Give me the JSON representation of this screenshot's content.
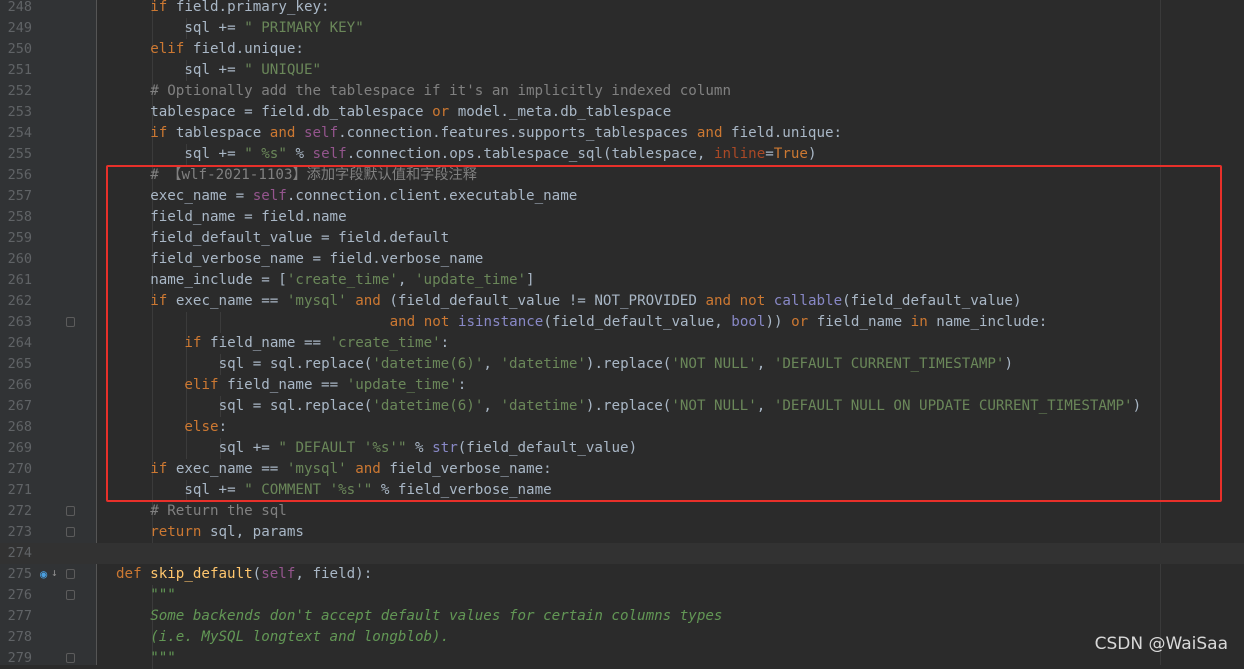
{
  "editor": {
    "lines": [
      {
        "num": "248",
        "tokens": [
          [
            "if",
            "kw"
          ],
          [
            " field.primary_key:",
            "op"
          ]
        ],
        "indent": 1
      },
      {
        "num": "249",
        "tokens": [
          [
            "sql += ",
            "op"
          ],
          [
            "\" PRIMARY KEY\"",
            "str"
          ]
        ],
        "indent": 2
      },
      {
        "num": "250",
        "tokens": [
          [
            "elif",
            "kw"
          ],
          [
            " field.unique:",
            "op"
          ]
        ],
        "indent": 1
      },
      {
        "num": "251",
        "tokens": [
          [
            "sql += ",
            "op"
          ],
          [
            "\" UNIQUE\"",
            "str"
          ]
        ],
        "indent": 2
      },
      {
        "num": "252",
        "tokens": [
          [
            "# Optionally add the tablespace if it's an implicitly indexed column",
            "cmt"
          ]
        ],
        "indent": 1
      },
      {
        "num": "253",
        "tokens": [
          [
            "tablespace = field.db_tablespace ",
            "op"
          ],
          [
            "or",
            "kw"
          ],
          [
            " model._meta.db_tablespace",
            "op"
          ]
        ],
        "indent": 1
      },
      {
        "num": "254",
        "tokens": [
          [
            "if",
            "kw"
          ],
          [
            " tablespace ",
            "op"
          ],
          [
            "and",
            "kw"
          ],
          [
            " ",
            "op"
          ],
          [
            "self",
            "self"
          ],
          [
            ".connection.features.supports_tablespaces ",
            "op"
          ],
          [
            "and",
            "kw"
          ],
          [
            " field.unique:",
            "op"
          ]
        ],
        "indent": 1
      },
      {
        "num": "255",
        "tokens": [
          [
            "sql += ",
            "op"
          ],
          [
            "\" %s\"",
            "str"
          ],
          [
            " % ",
            "op"
          ],
          [
            "self",
            "self"
          ],
          [
            ".connection.ops.tablespace_sql(tablespace, ",
            "op"
          ],
          [
            "inline",
            "param"
          ],
          [
            "=",
            "op"
          ],
          [
            "True",
            "kw"
          ],
          [
            ")",
            "op"
          ]
        ],
        "indent": 2
      },
      {
        "num": "256",
        "tokens": [
          [
            "# 【wlf-2021-1103】添加字段默认值和字段注释",
            "cmt"
          ]
        ],
        "indent": 1
      },
      {
        "num": "257",
        "tokens": [
          [
            "exec_name = ",
            "op"
          ],
          [
            "self",
            "self"
          ],
          [
            ".connection.client.executable_name",
            "op"
          ]
        ],
        "indent": 1
      },
      {
        "num": "258",
        "tokens": [
          [
            "field_name = field.name",
            "op"
          ]
        ],
        "indent": 1
      },
      {
        "num": "259",
        "tokens": [
          [
            "field_default_value = field.default",
            "op"
          ]
        ],
        "indent": 1
      },
      {
        "num": "260",
        "tokens": [
          [
            "field_verbose_name = field.verbose_name",
            "op"
          ]
        ],
        "indent": 1
      },
      {
        "num": "261",
        "tokens": [
          [
            "name_include = [",
            "op"
          ],
          [
            "'create_time'",
            "str"
          ],
          [
            ", ",
            "op"
          ],
          [
            "'update_time'",
            "str"
          ],
          [
            "]",
            "op"
          ]
        ],
        "indent": 1
      },
      {
        "num": "262",
        "tokens": [
          [
            "if",
            "kw"
          ],
          [
            " exec_name == ",
            "op"
          ],
          [
            "'mysql'",
            "str"
          ],
          [
            " ",
            "op"
          ],
          [
            "and",
            "kw"
          ],
          [
            " (field_default_value != NOT_PROVIDED ",
            "op"
          ],
          [
            "and",
            "kw"
          ],
          [
            " ",
            "op"
          ],
          [
            "not",
            "kw"
          ],
          [
            " ",
            "op"
          ],
          [
            "callable",
            "bi"
          ],
          [
            "(field_default_value)",
            "op"
          ]
        ],
        "indent": 1
      },
      {
        "num": "263",
        "tokens": [
          [
            "and",
            "kw"
          ],
          [
            " ",
            "op"
          ],
          [
            "not",
            "kw"
          ],
          [
            " ",
            "op"
          ],
          [
            "isinstance",
            "bi"
          ],
          [
            "(field_default_value, ",
            "op"
          ],
          [
            "bool",
            "bi"
          ],
          [
            ")) ",
            "op"
          ],
          [
            "or",
            "kw"
          ],
          [
            " field_name ",
            "op"
          ],
          [
            "in",
            "kw"
          ],
          [
            " name_include:",
            "op"
          ]
        ],
        "indent": 8,
        "fold": true
      },
      {
        "num": "264",
        "tokens": [
          [
            "if",
            "kw"
          ],
          [
            " field_name == ",
            "op"
          ],
          [
            "'create_time'",
            "str"
          ],
          [
            ":",
            "op"
          ]
        ],
        "indent": 2
      },
      {
        "num": "265",
        "tokens": [
          [
            "sql = sql.replace(",
            "op"
          ],
          [
            "'datetime(6)'",
            "str"
          ],
          [
            ", ",
            "op"
          ],
          [
            "'datetime'",
            "str"
          ],
          [
            ").replace(",
            "op"
          ],
          [
            "'NOT NULL'",
            "str"
          ],
          [
            ", ",
            "op"
          ],
          [
            "'DEFAULT CURRENT_TIMESTAMP'",
            "str"
          ],
          [
            ")",
            "op"
          ]
        ],
        "indent": 3
      },
      {
        "num": "266",
        "tokens": [
          [
            "elif",
            "kw"
          ],
          [
            " field_name == ",
            "op"
          ],
          [
            "'update_time'",
            "str"
          ],
          [
            ":",
            "op"
          ]
        ],
        "indent": 2
      },
      {
        "num": "267",
        "tokens": [
          [
            "sql = sql.replace(",
            "op"
          ],
          [
            "'datetime(6)'",
            "str"
          ],
          [
            ", ",
            "op"
          ],
          [
            "'datetime'",
            "str"
          ],
          [
            ").replace(",
            "op"
          ],
          [
            "'NOT NULL'",
            "str"
          ],
          [
            ", ",
            "op"
          ],
          [
            "'DEFAULT NULL ON UPDATE CURRENT_TIMESTAMP'",
            "str"
          ],
          [
            ")",
            "op"
          ]
        ],
        "indent": 3
      },
      {
        "num": "268",
        "tokens": [
          [
            "else",
            "kw"
          ],
          [
            ":",
            "op"
          ]
        ],
        "indent": 2
      },
      {
        "num": "269",
        "tokens": [
          [
            "sql += ",
            "op"
          ],
          [
            "\" DEFAULT '%s'\"",
            "str"
          ],
          [
            " % ",
            "op"
          ],
          [
            "str",
            "bi"
          ],
          [
            "(field_default_value)",
            "op"
          ]
        ],
        "indent": 3
      },
      {
        "num": "270",
        "tokens": [
          [
            "if",
            "kw"
          ],
          [
            " exec_name == ",
            "op"
          ],
          [
            "'mysql'",
            "str"
          ],
          [
            " ",
            "op"
          ],
          [
            "and",
            "kw"
          ],
          [
            " field_verbose_name:",
            "op"
          ]
        ],
        "indent": 1
      },
      {
        "num": "271",
        "tokens": [
          [
            "sql += ",
            "op"
          ],
          [
            "\" COMMENT '%s'\"",
            "str"
          ],
          [
            " % field_verbose_name",
            "op"
          ]
        ],
        "indent": 2
      },
      {
        "num": "272",
        "tokens": [
          [
            "# Return the sql",
            "cmt"
          ]
        ],
        "indent": 1,
        "fold": true
      },
      {
        "num": "273",
        "tokens": [
          [
            "return",
            "kw"
          ],
          [
            " sql, params",
            "op"
          ]
        ],
        "indent": 1,
        "fold": true
      },
      {
        "num": "274",
        "tokens": [],
        "indent": 0,
        "current": true
      },
      {
        "num": "275",
        "tokens": [
          [
            "def",
            "kw"
          ],
          [
            " ",
            "op"
          ],
          [
            "skip_default",
            "fn"
          ],
          [
            "(",
            "op"
          ],
          [
            "self",
            "self"
          ],
          [
            ", field):",
            "op"
          ]
        ],
        "indent": 0,
        "fold": true,
        "override": true
      },
      {
        "num": "276",
        "tokens": [
          [
            "\"\"\"",
            "doc"
          ]
        ],
        "indent": 1,
        "fold": true
      },
      {
        "num": "277",
        "tokens": [
          [
            "Some backends don't accept default values for certain columns types",
            "doc"
          ]
        ],
        "indent": 1
      },
      {
        "num": "278",
        "tokens": [
          [
            "(i.e. MySQL longtext and longblob).",
            "doc"
          ]
        ],
        "indent": 1
      },
      {
        "num": "279",
        "tokens": [
          [
            "\"\"\"",
            "doc"
          ]
        ],
        "indent": 1,
        "fold": true
      }
    ]
  },
  "watermark": "CSDN @WaiSaa",
  "colors": {
    "background": "#2b2b2b",
    "gutter": "#313335",
    "keyword": "#cc7832",
    "string": "#6a8759",
    "comment": "#808080",
    "highlight_box": "#e8302a"
  },
  "icons": {
    "gutter_override": "override-method-icon",
    "fold": "fold-marker-icon"
  }
}
